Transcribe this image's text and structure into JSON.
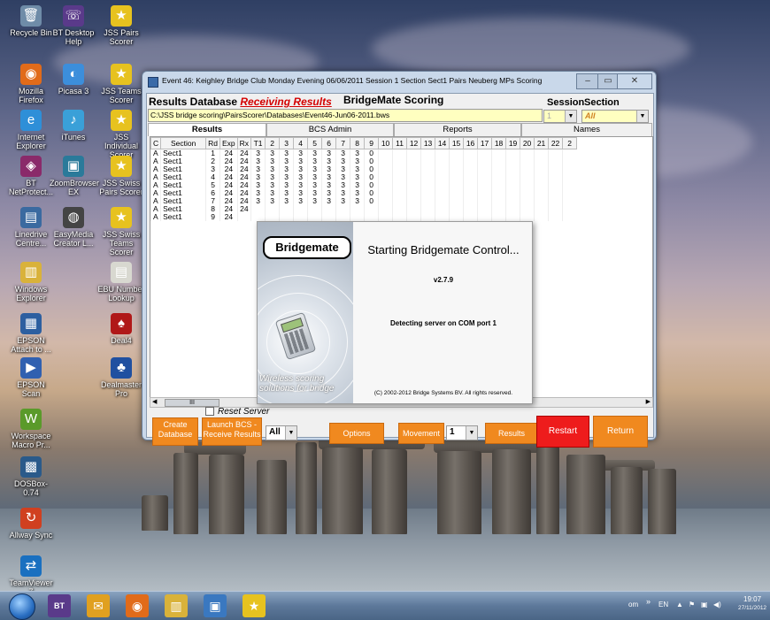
{
  "desktop": {
    "icons": [
      {
        "label": "Recycle Bin",
        "glyph": "🗑",
        "color": "#6f8ca8"
      },
      {
        "label": "BT Desktop Help",
        "glyph": "☏",
        "color": "#5a3a8a"
      },
      {
        "label": "JSS Pairs Scorer",
        "glyph": "★",
        "color": "#e7c21f"
      },
      {
        "label": "Mozilla Firefox",
        "glyph": "◉",
        "color": "#e16b1a"
      },
      {
        "label": "Picasa 3",
        "glyph": "◐",
        "color": "#3c8edb"
      },
      {
        "label": "JSS Teams Scorer",
        "glyph": "★",
        "color": "#e7c21f"
      },
      {
        "label": "Internet Explorer",
        "glyph": "e",
        "color": "#2e8fd8"
      },
      {
        "label": "iTunes",
        "glyph": "♪",
        "color": "#3aa0d8"
      },
      {
        "label": "JSS Individual Scorer",
        "glyph": "★",
        "color": "#e7c21f"
      },
      {
        "label": "BT NetProtect...",
        "glyph": "◈",
        "color": "#8a2a6a"
      },
      {
        "label": "ZoomBrowser EX",
        "glyph": "▣",
        "color": "#2a7a9a"
      },
      {
        "label": "JSS Swiss Pairs Scorer",
        "glyph": "★",
        "color": "#e7c21f"
      },
      {
        "label": "Linedrive Centre...",
        "glyph": "▤",
        "color": "#3a6aa0"
      },
      {
        "label": "EasyMedia Creator L...",
        "glyph": "◍",
        "color": "#444"
      },
      {
        "label": "JSS Swiss Teams Scorer",
        "glyph": "★",
        "color": "#e7c21f"
      },
      {
        "label": "Windows Explorer",
        "glyph": "▥",
        "color": "#d9b23a"
      },
      {
        "label": "EBU Number Lookup",
        "glyph": "▤",
        "color": "#d8d8d0"
      },
      {
        "label": "EPSON Attach to ...",
        "glyph": "▦",
        "color": "#2d5fa0"
      },
      {
        "label": "Deal4",
        "glyph": "♠",
        "color": "#b01818"
      },
      {
        "label": "EPSON Scan",
        "glyph": "▶",
        "color": "#3060b0"
      },
      {
        "label": "Dealmaster Pro",
        "glyph": "♣",
        "color": "#2050a0"
      },
      {
        "label": "Workspace Macro Pr...",
        "glyph": "W",
        "color": "#5a9a2a"
      },
      {
        "label": "DOSBox-0.74",
        "glyph": "▩",
        "color": "#2a5a8a"
      },
      {
        "label": "Allway Sync",
        "glyph": "↻",
        "color": "#d04020"
      },
      {
        "label": "TeamViewer 7",
        "glyph": "⇄",
        "color": "#1a70c0"
      }
    ]
  },
  "window": {
    "title": "Event 46: Keighley Bridge Club Monday Evening 06/06/2011 Session 1 Section Sect1 Pairs Neuberg MPs Scoring",
    "db_label": "Results Database",
    "receiving_label": "Receiving Results",
    "app_label": "BridgeMate Scoring",
    "db_path": "C:\\JSS bridge scoring\\PairsScorer\\Databases\\Event46-Jun06-2011.bws",
    "session_label": "Session",
    "section_label": "Section",
    "session_value": "1",
    "section_value": "All",
    "tabs": [
      "Results",
      "BCS Admin",
      "Reports",
      "Names"
    ],
    "columns": [
      "C",
      "Section",
      "Rd",
      "Exp",
      "Rx",
      "T1",
      "2",
      "3",
      "4",
      "5",
      "6",
      "7",
      "8",
      "9",
      "10",
      "11",
      "12",
      "13",
      "14",
      "15",
      "16",
      "17",
      "18",
      "19",
      "20",
      "21",
      "22",
      "2"
    ],
    "rows": [
      {
        "c": "A",
        "section": "Sect1",
        "rd": "1",
        "exp": "24",
        "rx": "24",
        "t": [
          "3",
          "3",
          "3",
          "3",
          "3",
          "3",
          "3",
          "3",
          "0"
        ]
      },
      {
        "c": "A",
        "section": "Sect1",
        "rd": "2",
        "exp": "24",
        "rx": "24",
        "t": [
          "3",
          "3",
          "3",
          "3",
          "3",
          "3",
          "3",
          "3",
          "0"
        ]
      },
      {
        "c": "A",
        "section": "Sect1",
        "rd": "3",
        "exp": "24",
        "rx": "24",
        "t": [
          "3",
          "3",
          "3",
          "3",
          "3",
          "3",
          "3",
          "3",
          "0"
        ]
      },
      {
        "c": "A",
        "section": "Sect1",
        "rd": "4",
        "exp": "24",
        "rx": "24",
        "t": [
          "3",
          "3",
          "3",
          "3",
          "3",
          "3",
          "3",
          "3",
          "0"
        ]
      },
      {
        "c": "A",
        "section": "Sect1",
        "rd": "5",
        "exp": "24",
        "rx": "24",
        "t": [
          "3",
          "3",
          "3",
          "3",
          "3",
          "3",
          "3",
          "3",
          "0"
        ]
      },
      {
        "c": "A",
        "section": "Sect1",
        "rd": "6",
        "exp": "24",
        "rx": "24",
        "t": [
          "3",
          "3",
          "3",
          "3",
          "3",
          "3",
          "3",
          "3",
          "0"
        ]
      },
      {
        "c": "A",
        "section": "Sect1",
        "rd": "7",
        "exp": "24",
        "rx": "24",
        "t": [
          "3",
          "3",
          "3",
          "3",
          "3",
          "3",
          "3",
          "3",
          "0"
        ]
      },
      {
        "c": "A",
        "section": "Sect1",
        "rd": "8",
        "exp": "24",
        "rx": "24",
        "t": [
          "",
          "",
          "",
          "",
          "",
          "",
          "",
          "",
          ""
        ]
      },
      {
        "c": "A",
        "section": "Sect1",
        "rd": "9",
        "exp": "24",
        "rx": "",
        "t": [
          "",
          "",
          "",
          "",
          "",
          "",
          "",
          "",
          ""
        ]
      }
    ],
    "scroll_thumb": "III",
    "reset_server": "Reset Server",
    "buttons": {
      "create_db": "Create Database",
      "launch_bcs": "Launch BCS - Receive Results",
      "all_value": "All",
      "options": "Options",
      "movement": "Movement",
      "movement_value": "1",
      "results": "Results",
      "restart": "Restart",
      "return": "Return"
    }
  },
  "splash": {
    "logo": "Bridgemate",
    "title": "Starting Bridgemate Control...",
    "version": "v2.7.9",
    "status": "Detecting server on COM port 1",
    "tagline": "Wireless scoring solutions for bridge",
    "copyright": "(C) 2002-2012 Bridge Systems BV. All rights reserved."
  },
  "taskbar": {
    "lang": "EN",
    "user": "om",
    "time": "19:07",
    "date": "27/11/2012",
    "pinned": [
      {
        "name": "bt-icon",
        "glyph": "BT",
        "color": "#5a3a8a"
      },
      {
        "name": "outlook-icon",
        "glyph": "✉",
        "color": "#e0a020"
      },
      {
        "name": "firefox-icon",
        "glyph": "◉",
        "color": "#e16b1a"
      },
      {
        "name": "explorer-icon",
        "glyph": "▥",
        "color": "#d9b23a"
      },
      {
        "name": "app-icon",
        "glyph": "▣",
        "color": "#3a78c0"
      },
      {
        "name": "jss-icon",
        "glyph": "★",
        "color": "#e7c21f"
      }
    ]
  }
}
